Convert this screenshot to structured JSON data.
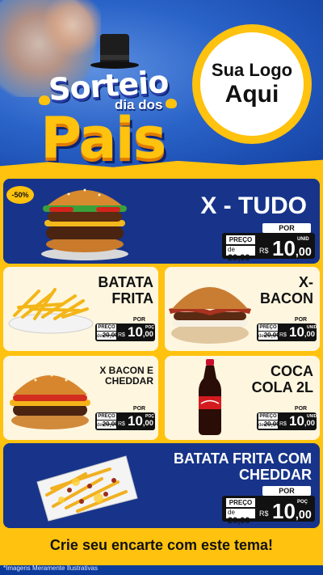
{
  "header": {
    "title_line1": "Sorteio",
    "title_line2": "dia dos",
    "title_line3": "Pais",
    "logo_line1": "Sua Logo",
    "logo_line2": "Aqui"
  },
  "featured": {
    "badge": "-50%",
    "name": "X - TUDO",
    "por": "POR",
    "preco": "PREÇO",
    "old_prefix": "de",
    "old_price": "20,00",
    "currency": "R$",
    "price_int": "10",
    "price_cents": ",00",
    "unit": "UNID"
  },
  "items": [
    {
      "name_line1": "BATATA",
      "name_line2": "FRITA",
      "por": "POR",
      "preco": "PREÇO",
      "old_prefix": "de",
      "old_price": "20,00",
      "currency": "R$",
      "price_int": "10",
      "price_cents": ",00",
      "unit": "POÇ"
    },
    {
      "name_line1": "X-",
      "name_line2": "BACON",
      "por": "POR",
      "preco": "PREÇO",
      "old_prefix": "de",
      "old_price": "20,00",
      "currency": "R$",
      "price_int": "10",
      "price_cents": ",00",
      "unit": "UNID"
    },
    {
      "name_line1": "X BACON E",
      "name_line2": "CHEDDAR",
      "por": "POR",
      "preco": "PREÇO",
      "old_prefix": "de",
      "old_price": "20,00",
      "currency": "R$",
      "price_int": "10",
      "price_cents": ",00",
      "unit": "POÇ"
    },
    {
      "name_line1": "COCA",
      "name_line2": "COLA 2L",
      "por": "POR",
      "preco": "PREÇO",
      "old_prefix": "de",
      "old_price": "20,00",
      "currency": "R$",
      "price_int": "10",
      "price_cents": ",00",
      "unit": "UNID"
    }
  ],
  "bottom": {
    "name_line1": "BATATA FRITA COM",
    "name_line2": "CHEDDAR",
    "por": "POR",
    "preco": "PREÇO",
    "old_prefix": "de",
    "old_price": "20,00",
    "currency": "R$",
    "price_int": "10",
    "price_cents": ",00",
    "unit": "POÇ"
  },
  "footer": {
    "cta": "Crie seu encarte com este tema!",
    "disclaimer": "*Imagens Meramente Ilustrativas"
  },
  "colors": {
    "brand_blue": "#17348a",
    "brand_yellow": "#ffc20e",
    "cream": "#fff6df"
  }
}
